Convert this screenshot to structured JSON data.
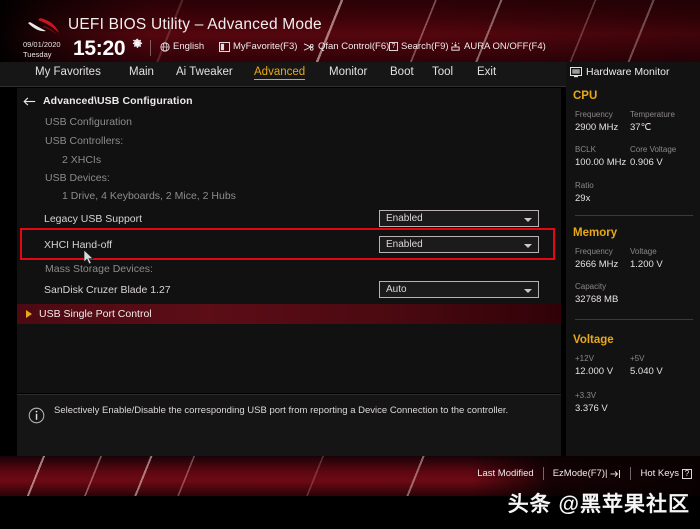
{
  "header": {
    "title": "UEFI BIOS Utility – Advanced Mode",
    "date": "09/01/2020",
    "weekday": "Tuesday",
    "time": "15:20",
    "gear_icon": "gear-icon",
    "logo_icon": "rog-logo-icon",
    "shortcuts": [
      {
        "label": "English",
        "icon": "globe-icon"
      },
      {
        "label": "MyFavorite(F3)",
        "icon": "book-icon"
      },
      {
        "label": "Qfan Control(F6)",
        "icon": "fan-icon"
      },
      {
        "label": "Search(F9)",
        "icon": "question-box-icon"
      },
      {
        "label": "AURA ON/OFF(F4)",
        "icon": "aura-icon"
      }
    ]
  },
  "tabs": [
    {
      "label": "My Favorites",
      "active": false
    },
    {
      "label": "Main",
      "active": false
    },
    {
      "label": "Ai Tweaker",
      "active": false
    },
    {
      "label": "Advanced",
      "active": true
    },
    {
      "label": "Monitor",
      "active": false
    },
    {
      "label": "Boot",
      "active": false
    },
    {
      "label": "Tool",
      "active": false
    },
    {
      "label": "Exit",
      "active": false
    }
  ],
  "main": {
    "breadcrumb": "Advanced\\USB Configuration",
    "back_icon": "back-arrow-icon",
    "info_lines": [
      "USB Configuration",
      "USB Controllers:",
      "2 XHCIs",
      "USB Devices:",
      "1 Drive, 4 Keyboards, 2 Mice, 2 Hubs"
    ],
    "mass_storage_header": "Mass Storage Devices:",
    "options": [
      {
        "label": "Legacy USB Support",
        "value": "Enabled"
      },
      {
        "label": "XHCI Hand-off",
        "value": "Enabled"
      },
      {
        "label": "SanDisk Cruzer Blade 1.27",
        "value": "Auto"
      }
    ],
    "submenu": {
      "label": "USB Single Port Control",
      "arrow_icon": "triangle-right-icon"
    },
    "highlight_color": "#e30613",
    "accent_color": "#e8a817"
  },
  "help": {
    "icon": "info-icon",
    "text": "Selectively Enable/Disable the corresponding USB port from reporting a Device Connection to the controller."
  },
  "sidebar": {
    "title": "Hardware Monitor",
    "title_icon": "monitor-icon",
    "sections": [
      {
        "name": "CPU",
        "rows": [
          [
            {
              "key": "Frequency",
              "value": "2900 MHz"
            },
            {
              "key": "Temperature",
              "value": "37℃"
            }
          ],
          [
            {
              "key": "BCLK",
              "value": "100.00 MHz"
            },
            {
              "key": "Core Voltage",
              "value": "0.906 V"
            }
          ],
          [
            {
              "key": "Ratio",
              "value": "29x"
            }
          ]
        ]
      },
      {
        "name": "Memory",
        "rows": [
          [
            {
              "key": "Frequency",
              "value": "2666 MHz"
            },
            {
              "key": "Voltage",
              "value": "1.200 V"
            }
          ],
          [
            {
              "key": "Capacity",
              "value": "32768 MB"
            }
          ]
        ]
      },
      {
        "name": "Voltage",
        "rows": [
          [
            {
              "key": "+12V",
              "value": "12.000 V"
            },
            {
              "key": "+5V",
              "value": "5.040 V"
            }
          ],
          [
            {
              "key": "+3.3V",
              "value": "3.376 V"
            }
          ]
        ]
      }
    ]
  },
  "footer": {
    "last_modified": "Last Modified",
    "ezmode": "EzMode(F7)|",
    "ezmode_icon": "arrow-right-box-icon",
    "hotkeys": "Hot Keys",
    "hotkeys_icon": "question-box-icon",
    "watermark": "头条 @黑苹果社区"
  }
}
